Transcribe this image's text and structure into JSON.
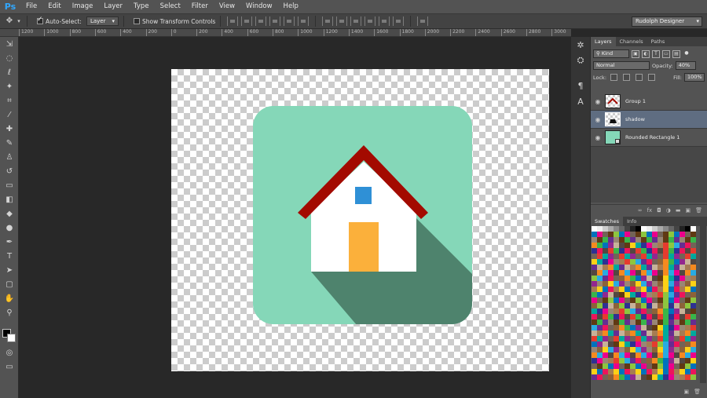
{
  "app": {
    "logo": "Ps"
  },
  "menu": [
    "File",
    "Edit",
    "Image",
    "Layer",
    "Type",
    "Select",
    "Filter",
    "View",
    "Window",
    "Help"
  ],
  "options": {
    "auto_select_label": "Auto-Select:",
    "auto_select_target": "Layer",
    "show_transform_label": "Show Transform Controls",
    "workspace": "Rudolph Designer"
  },
  "ruler": [
    "1200",
    "1000",
    "800",
    "600",
    "400",
    "200",
    "0",
    "200",
    "400",
    "600",
    "800",
    "1000",
    "1200",
    "1400",
    "1600",
    "1800",
    "2000",
    "2200",
    "2400",
    "2600",
    "2800",
    "3000"
  ],
  "layers_panel": {
    "tabs": [
      "Layers",
      "Channels",
      "Paths"
    ],
    "filter_kind": "Kind",
    "blend_mode": "Normal",
    "opacity_label": "Opacity:",
    "opacity_value": "40%",
    "lock_label": "Lock:",
    "fill_label": "Fill:",
    "fill_value": "100%",
    "layers": [
      {
        "name": "Group 1",
        "selected": false
      },
      {
        "name": "shadow",
        "selected": true
      },
      {
        "name": "Rounded Rectangle 1",
        "selected": false
      }
    ]
  },
  "swatches_panel": {
    "tabs": [
      "Swatches",
      "Info"
    ]
  },
  "artwork": {
    "background_color": "#85d7b8",
    "shadow_color": "#4e836d",
    "roof_color": "#a30a00",
    "wall_color": "#ffffff",
    "window_color": "#2f90d6",
    "door_color": "#fbb03b"
  }
}
